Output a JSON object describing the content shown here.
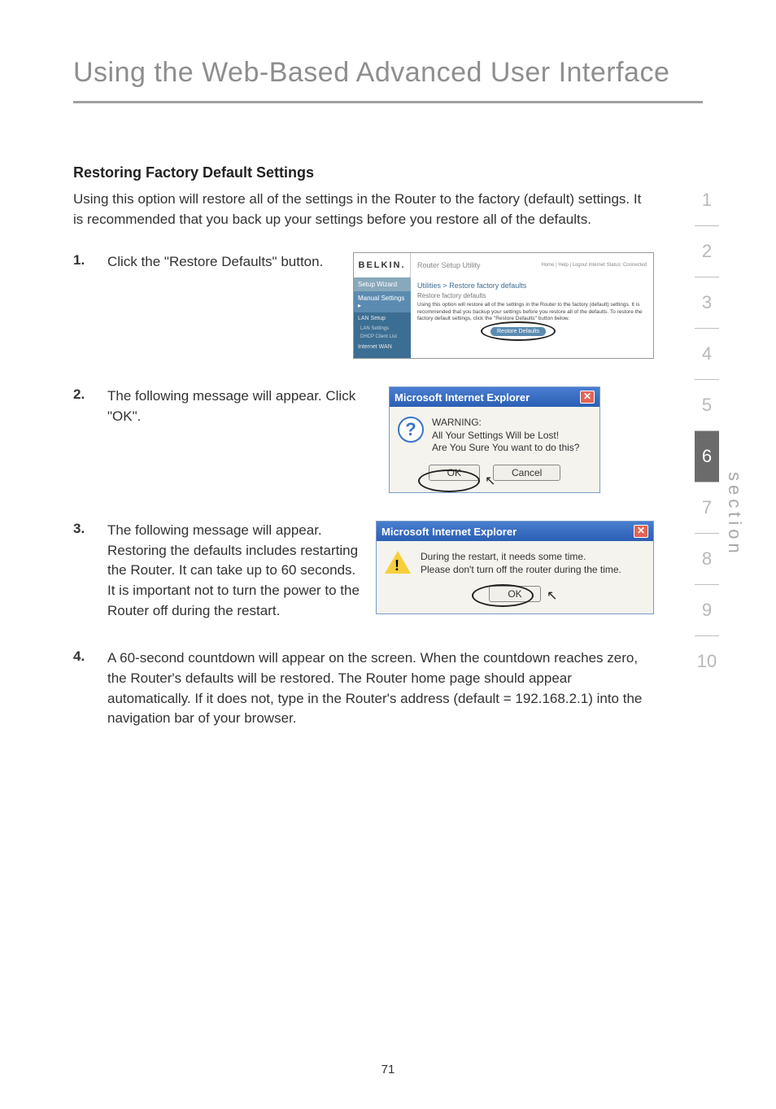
{
  "page_title": "Using the Web-Based Advanced User Interface",
  "subheading": "Restoring Factory Default Settings",
  "intro": "Using this option will restore all of the settings in the Router to the factory (default) settings. It is recommended that you back up your settings before you restore all of the defaults.",
  "steps": {
    "s1": {
      "num": "1.",
      "text": "Click the \"Restore Defaults\" button."
    },
    "s2": {
      "num": "2.",
      "text": "The following message will appear. Click \"OK\"."
    },
    "s3": {
      "num": "3.",
      "text": "The following message will appear. Restoring the defaults includes restarting the Router. It can take up to 60 seconds. It is important not to turn the power to the Router off during the restart."
    },
    "s4": {
      "num": "4.",
      "text": "A 60-second countdown will appear on the screen. When the countdown reaches zero, the Router's defaults will be restored. The Router home page should appear automatically. If it does not, type in the Router's address (default = 192.168.2.1) into the navigation bar of your browser."
    }
  },
  "section_nav": [
    "1",
    "2",
    "3",
    "4",
    "5",
    "6",
    "7",
    "8",
    "9",
    "10"
  ],
  "section_active_index": 5,
  "section_label": "section",
  "page_number": "71",
  "belkin": {
    "logo": "BELKIN.",
    "util_title": "Router Setup Utility",
    "links": "Home | Help | Logout   Internet Status: Connected",
    "side_wizard": "Setup Wizard",
    "side_manual": "Manual Settings ▸",
    "side_lan": "LAN Setup",
    "side_lan_s": "LAN Settings",
    "side_dhcp": "DHCP Client List",
    "side_wan": "Internet WAN",
    "main_title": "Utilities > Restore factory defaults",
    "main_sub": "Restore factory defaults",
    "main_txt": "Using this option will restore all of the settings in the Router to the factory (default) settings. It is recommended that you backup your settings before you restore all of the defaults. To restore the factory default settings, click the \"Restore Defaults\" button below.",
    "btn": "Restore Defaults"
  },
  "dialog1": {
    "title": "Microsoft Internet Explorer",
    "line1": "WARNING:",
    "line2": "All Your Settings Will be Lost!",
    "line3": "Are You Sure You want to do this?",
    "ok": "OK",
    "cancel": "Cancel"
  },
  "dialog2": {
    "title": "Microsoft Internet Explorer",
    "line1": "During the restart, it needs some time.",
    "line2": "Please don't turn off the router during the time.",
    "ok": "OK"
  }
}
